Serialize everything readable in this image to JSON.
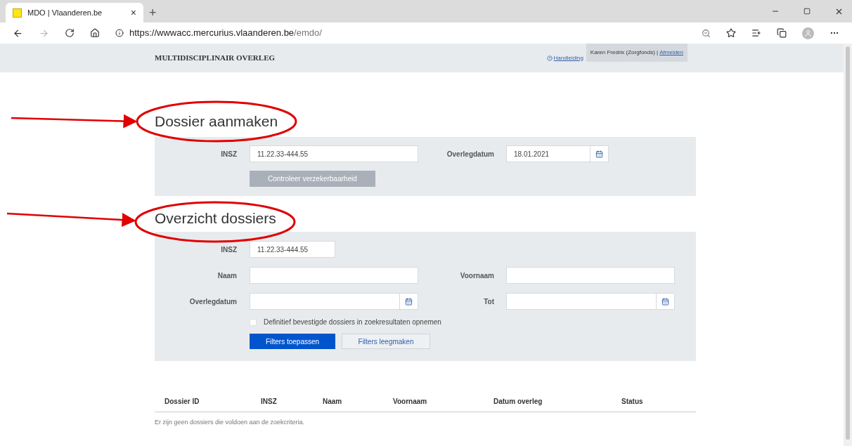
{
  "browser": {
    "tab_title": "MDO | Vlaanderen.be",
    "tab_close": "×",
    "new_tab": "+",
    "url_host": "https://wwwacc.mercurius.vlaanderen.be",
    "url_path": "/emdo/"
  },
  "header": {
    "title": "MULTIDISCIPLINAIR OVERLEG",
    "help_link": "Handleiding",
    "user": "Karen Fredrix (Zorgfonds) |",
    "logout": "Afmelden"
  },
  "create": {
    "heading": "Dossier aanmaken",
    "fields": [
      {
        "label": "INSZ",
        "value": "11.22.33-444.55",
        "kind": "text"
      },
      {
        "label": "Overlegdatum",
        "value": "18.01.2021",
        "kind": "date"
      }
    ],
    "button": {
      "label": "Controleer verzekerbaarheid",
      "disabled": true
    }
  },
  "overview": {
    "heading": "Overzicht dossiers",
    "insz": {
      "label": "INSZ",
      "value": "11.22.33-444.55"
    },
    "rows": [
      [
        {
          "label": "Naam",
          "kind": "text"
        },
        {
          "label": "Voornaam",
          "kind": "text"
        }
      ],
      [
        {
          "label": "Overlegdatum",
          "kind": "date"
        },
        {
          "label": "Tot",
          "kind": "date"
        }
      ]
    ],
    "checkbox": {
      "label": "Definitief bevestigde dossiers in zoekresultaten opnemen",
      "checked": false
    },
    "buttons": [
      {
        "label": "Filters toepassen",
        "kind": "primary"
      },
      {
        "label": "Filters leegmaken",
        "kind": "secondary"
      }
    ]
  },
  "table": {
    "columns": [
      "Dossier ID",
      "INSZ",
      "Naam",
      "Voornaam",
      "Datum overleg",
      "Status"
    ],
    "empty_message": "Er zijn geen dossiers die voldoen aan de zoekcriteria."
  }
}
